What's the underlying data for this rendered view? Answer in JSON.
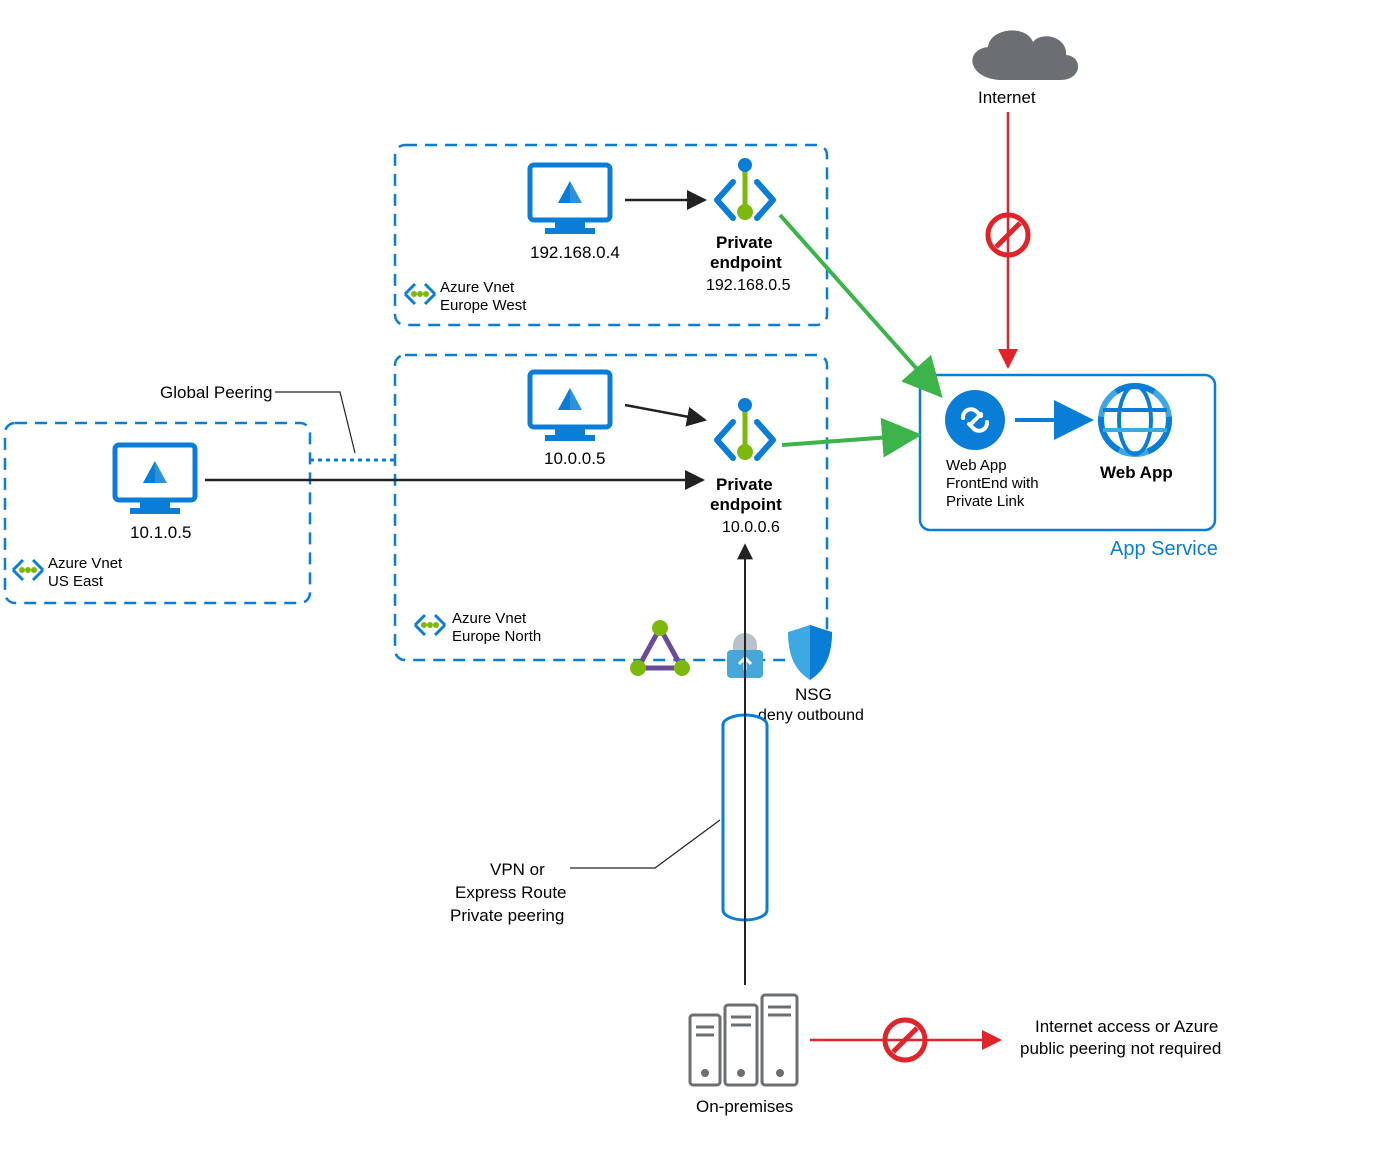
{
  "internet": {
    "label": "Internet"
  },
  "appService": {
    "groupLabel": "App Service",
    "frontend": {
      "label1": "Web App",
      "label2": "FrontEnd with",
      "label3": "Private Link"
    },
    "webapp": {
      "label": "Web App"
    }
  },
  "vnets": {
    "eurowest": {
      "label1": "Azure Vnet",
      "label2": "Europe West",
      "vm": {
        "ip": "192.168.0.4"
      },
      "pe": {
        "title": "Private",
        "title2": "endpoint",
        "ip": "192.168.0.5"
      }
    },
    "euronorth": {
      "label1": "Azure Vnet",
      "label2": "Europe North",
      "vm": {
        "ip": "10.0.0.5"
      },
      "pe": {
        "title": "Private",
        "title2": "endpoint",
        "ip": "10.0.0.6"
      }
    },
    "useast": {
      "label1": "Azure Vnet",
      "label2": "US East",
      "vm": {
        "ip": "10.1.0.5"
      }
    }
  },
  "nsg": {
    "label": "NSG",
    "sub": "deny outbound"
  },
  "onprem": {
    "label": "On-premises"
  },
  "notes": {
    "globalPeering": "Global Peering",
    "vpn1": "VPN or",
    "vpn2": "Express Route",
    "vpn3": "Private peering",
    "noInternet1": "Internet access or Azure",
    "noInternet2": "public peering not required"
  },
  "colors": {
    "azureBlue": "#0a7dd6",
    "green": "#3cb44a",
    "red": "#e1242a",
    "gray": "#6c6f72",
    "lime": "#7db90d",
    "purple": "#6a4b9a"
  }
}
